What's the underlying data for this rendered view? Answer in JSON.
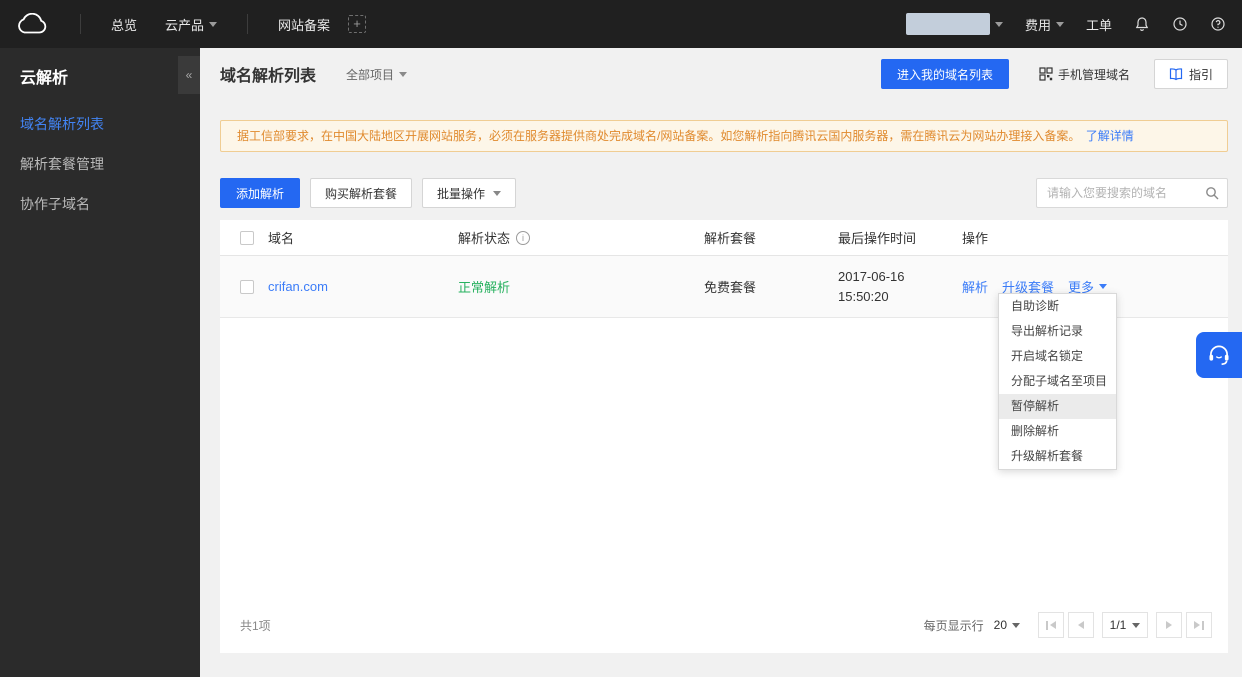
{
  "topbar": {
    "overview": "总览",
    "cloud_products": "云产品",
    "website_filing": "网站备案",
    "billing": "费用",
    "ticket": "工单"
  },
  "sidebar": {
    "title": "云解析",
    "collapse": "«",
    "items": [
      {
        "label": "域名解析列表",
        "active": true
      },
      {
        "label": "解析套餐管理",
        "active": false
      },
      {
        "label": "协作子域名",
        "active": false
      }
    ]
  },
  "header": {
    "title": "域名解析列表",
    "project_filter": "全部项目",
    "primary_button": "进入我的域名列表",
    "phone_manage": "手机管理域名",
    "guide": "指引"
  },
  "notice": {
    "text": "据工信部要求，在中国大陆地区开展网站服务，必须在服务器提供商处完成域名/网站备案。如您解析指向腾讯云国内服务器，需在腾讯云为网站办理接入备案。",
    "link": "了解详情"
  },
  "toolbar": {
    "add": "添加解析",
    "buy": "购买解析套餐",
    "batch": "批量操作",
    "search_placeholder": "请输入您要搜索的域名"
  },
  "table": {
    "columns": [
      "域名",
      "解析状态",
      "解析套餐",
      "最后操作时间",
      "操作"
    ],
    "rows": [
      {
        "domain": "crifan.com",
        "status": "正常解析",
        "plan": "免费套餐",
        "date": "2017-06-16",
        "time": "15:50:20",
        "action_resolve": "解析",
        "action_upgrade": "升级套餐",
        "action_more": "更多"
      }
    ]
  },
  "more_menu": {
    "items": [
      "自助诊断",
      "导出解析记录",
      "开启域名锁定",
      "分配子域名至项目",
      "暂停解析",
      "删除解析",
      "升级解析套餐"
    ],
    "highlighted": "暂停解析"
  },
  "footer": {
    "total": "共1项",
    "per_page_label": "每页显示行",
    "per_page_value": "20",
    "page_indicator": "1/1"
  },
  "colors": {
    "accent_blue": "#2468f2",
    "link_blue": "#3b7cf8",
    "status_green": "#27b15f",
    "notice_text": "#e08a2e",
    "notice_bg": "#fdf6e8",
    "notice_border": "#f0cd93",
    "topbar_bg": "#202020",
    "sidebar_bg": "#2b2b2b"
  }
}
